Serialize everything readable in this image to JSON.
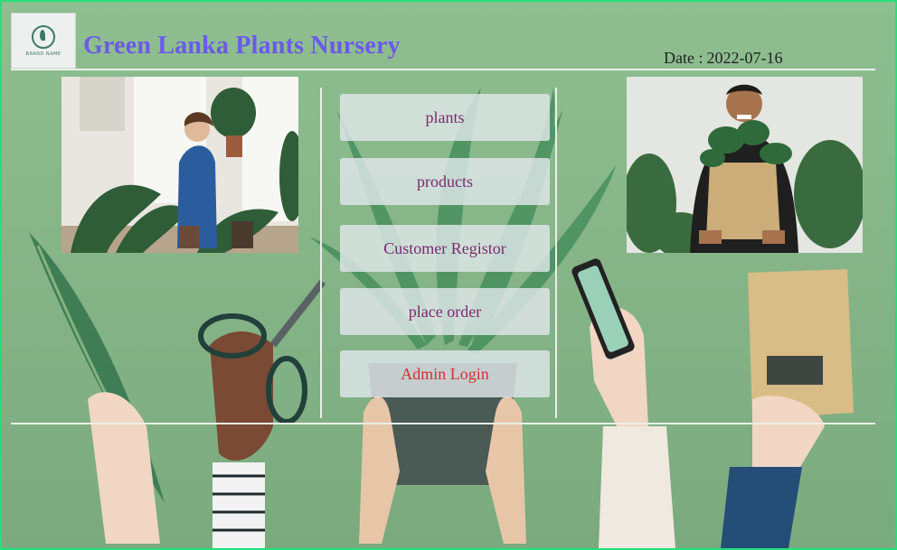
{
  "header": {
    "brand_logo_text": "BRAND NAME",
    "title": "Green Lanka Plants Nursery",
    "date_label": "Date :",
    "date_value": "2022-07-16"
  },
  "menu": {
    "items": [
      {
        "label": "plants"
      },
      {
        "label": "products"
      },
      {
        "label": "Customer Registor"
      },
      {
        "label": "place order"
      },
      {
        "label": "Admin Login"
      }
    ]
  },
  "colors": {
    "background": "#86b588",
    "frame_border": "#22e07a",
    "title": "#6b5be6",
    "menu_text": "#7a2b6e",
    "admin_text": "#d23232"
  }
}
